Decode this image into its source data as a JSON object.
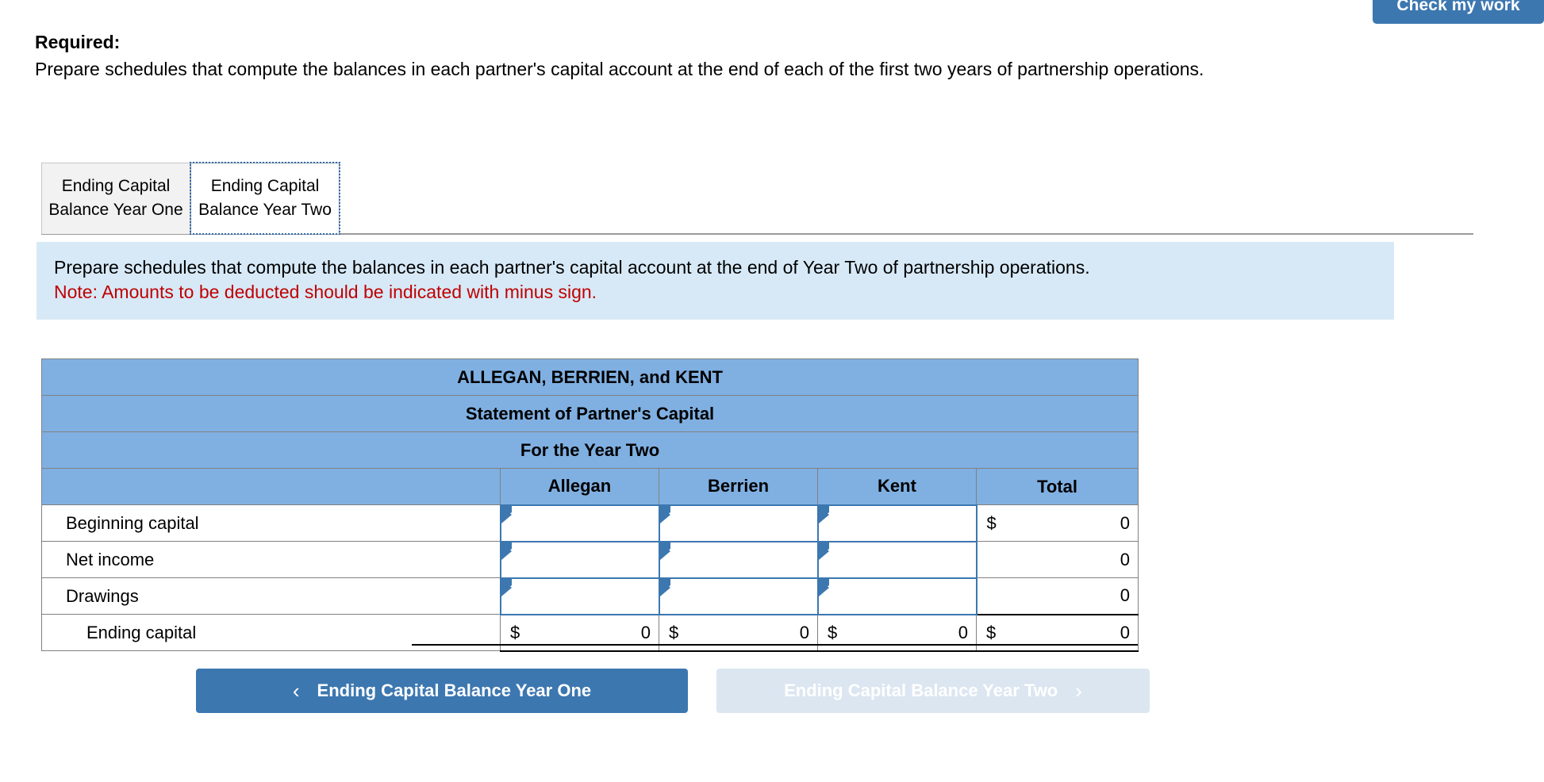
{
  "toolbar": {
    "check_my_work_label": "Check my work"
  },
  "required": {
    "heading": "Required:",
    "body": "Prepare schedules that compute the balances in each partner's capital account at the end of each of the first two years of partnership operations."
  },
  "tabs": [
    {
      "label": "Ending Capital Balance Year One",
      "state": "inactive"
    },
    {
      "label": "Ending Capital Balance Year Two",
      "state": "active"
    }
  ],
  "instruction": {
    "text": "Prepare schedules that compute the balances in each partner's capital account at the end of Year Two of partnership operations.",
    "note": "Note: Amounts to be deducted should be indicated with minus sign.",
    "note_color": "#c00000",
    "background": "#d7e9f7"
  },
  "worksheet": {
    "title_lines": [
      "ALLEGAN, BERRIEN, and KENT",
      "Statement of Partner's Capital",
      "For the Year Two"
    ],
    "header_color": "#80b0e2",
    "columns": [
      "",
      "Allegan",
      "Berrien",
      "Kent",
      "Total"
    ],
    "rows": [
      {
        "label": "Beginning capital",
        "indent": false,
        "type": "input",
        "allegan": "",
        "berrien": "",
        "kent": "",
        "total_symbol": "$",
        "total_value": "0"
      },
      {
        "label": "Net income",
        "indent": false,
        "type": "input",
        "allegan": "",
        "berrien": "",
        "kent": "",
        "total_symbol": "",
        "total_value": "0"
      },
      {
        "label": "Drawings",
        "indent": false,
        "type": "input",
        "allegan": "",
        "berrien": "",
        "kent": "",
        "total_symbol": "",
        "total_value": "0"
      },
      {
        "label": "Ending capital",
        "indent": true,
        "type": "total",
        "allegan_symbol": "$",
        "allegan_value": "0",
        "berrien_symbol": "$",
        "berrien_value": "0",
        "kent_symbol": "$",
        "kent_value": "0",
        "total_symbol": "$",
        "total_value": "0"
      }
    ]
  },
  "navigation": {
    "prev_label": "Ending Capital Balance Year One",
    "prev_chevron": "‹",
    "next_label": "Ending Capital Balance Year Two",
    "next_chevron": "›",
    "prev_color": "#3c77b0",
    "next_color": "#dbe6f1"
  }
}
